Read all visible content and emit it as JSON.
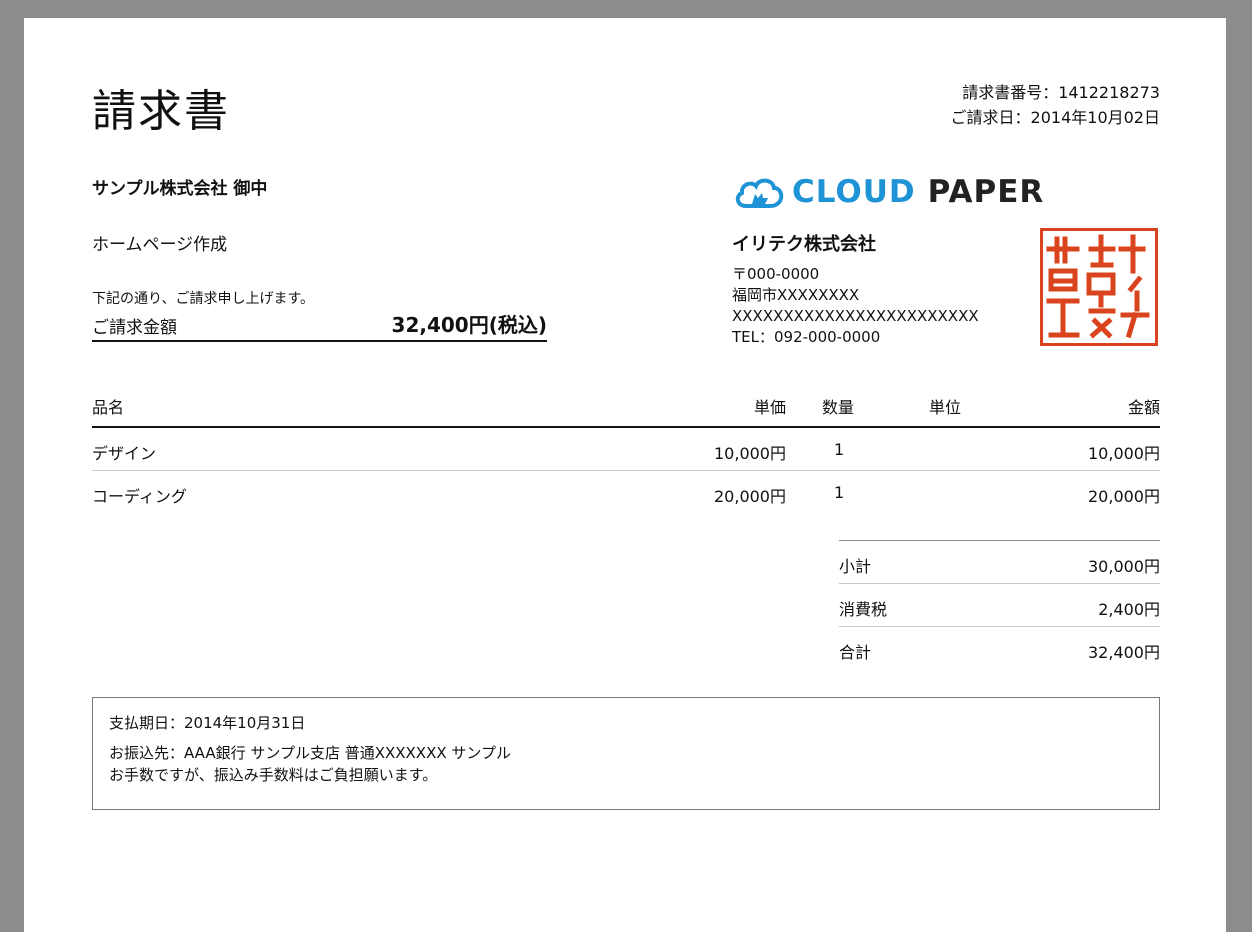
{
  "document": {
    "title": "請求書",
    "invoice_number": "請求書番号：1412218273",
    "invoice_date": "ご請求日：2014年10月02日"
  },
  "client": {
    "name": "サンプル株式会社 御中",
    "subject": "ホームページ作成",
    "note": "下記の通り、ご請求申し上げます。",
    "total_label": "ご請求金額",
    "total_value": "32,400円(税込)"
  },
  "issuer": {
    "logo_text_1": "CLOUD",
    "logo_text_2": "PAPER",
    "company": "イリテク株式会社",
    "postal": "〒000-0000",
    "city": "福岡市XXXXXXXX",
    "street": "XXXXXXXXXXXXXXXXXXXXXXXX",
    "tel": "TEL：092-000-0000",
    "seal_text": "イリテク株式会社之印",
    "seal_color": "#d9441f",
    "logo_color": "#1e93d6"
  },
  "table": {
    "headers": {
      "name": "品名",
      "price": "単価",
      "qty": "数量",
      "unit": "単位",
      "amount": "金額"
    },
    "rows": [
      {
        "name": "デザイン",
        "price": "10,000円",
        "qty": "1",
        "unit": "",
        "amount": "10,000円"
      },
      {
        "name": "コーディング",
        "price": "20,000円",
        "qty": "1",
        "unit": "",
        "amount": "20,000円"
      }
    ]
  },
  "summary": {
    "subtotal_label": "小計",
    "subtotal": "30,000円",
    "tax_label": "消費税",
    "tax": "2,400円",
    "total_label": "合計",
    "total": "32,400円"
  },
  "payment": {
    "due": "支払期日：2014年10月31日",
    "bank": "お振込先：AAA銀行 サンプル支店 普通XXXXXXX サンプル",
    "fee_note": "お手数ですが、振込み手数料はご負担願います。"
  }
}
